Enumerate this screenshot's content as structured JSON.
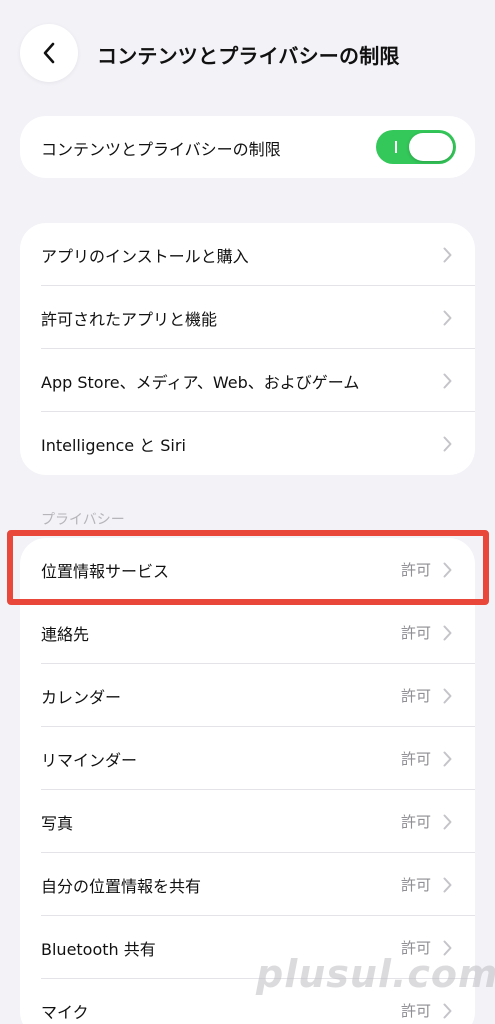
{
  "header": {
    "title": "コンテンツとプライバシーの制限",
    "back_icon": "chevron-left-icon"
  },
  "master_toggle": {
    "label": "コンテンツとプライバシーの制限",
    "on": true,
    "color": "#34c759"
  },
  "menu": {
    "items": [
      {
        "label": "アプリのインストールと購入"
      },
      {
        "label": "許可されたアプリと機能"
      },
      {
        "label": "App Store、メディア、Web、およびゲーム"
      },
      {
        "label": "Intelligence と Siri"
      }
    ]
  },
  "privacy": {
    "header": "プライバシー",
    "items": [
      {
        "label": "位置情報サービス",
        "value": "許可"
      },
      {
        "label": "連絡先",
        "value": "許可"
      },
      {
        "label": "カレンダー",
        "value": "許可"
      },
      {
        "label": "リマインダー",
        "value": "許可"
      },
      {
        "label": "写真",
        "value": "許可"
      },
      {
        "label": "自分の位置情報を共有",
        "value": "許可"
      },
      {
        "label": "Bluetooth 共有",
        "value": "許可"
      },
      {
        "label": "マイク",
        "value": "許可"
      }
    ]
  },
  "highlight_color": "#e8473a",
  "watermark": "plusul.com"
}
